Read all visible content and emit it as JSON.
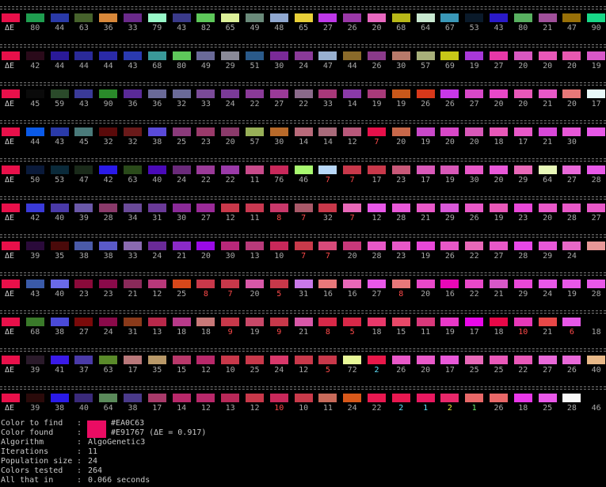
{
  "delta_label": "ΔE",
  "generations": [
    {
      "colors": [
        "#e8104a",
        "#1f9e50",
        "#2a3aa8",
        "#46622c",
        "#d8883a",
        "#6a2a8a",
        "#98f8c8",
        "#3a3a8a",
        "#5ec85a",
        "#dcf098",
        "#6a8a7a",
        "#90a8d0",
        "#e8d038",
        "#be38e8",
        "#9a38a8",
        "#e868c0",
        "#b8b818",
        "#c8e8d0",
        "#3a98b8",
        "#0a1a2a",
        "#2a1ac8",
        "#58b060",
        "#a0509a",
        "#987008",
        "#18d888"
      ],
      "deltas": [
        "80",
        "44",
        "63",
        "36",
        "33",
        "79",
        "43",
        "82",
        "65",
        "49",
        "48",
        "65",
        "27",
        "26",
        "20",
        "68",
        "64",
        "67",
        "53",
        "43",
        "80",
        "21",
        "47",
        "90"
      ],
      "flags": []
    },
    {
      "colors": [
        "#e8104a",
        "#2a0a1a",
        "#2a1a98",
        "#2a2a98",
        "#2a2aa8",
        "#2a3ab0",
        "#3a9898",
        "#5ec85a",
        "#6a6a98",
        "#8a8a98",
        "#2a5a8a",
        "#7a2a98",
        "#8a3a98",
        "#98b0d0",
        "#8a6a2a",
        "#8a3a8a",
        "#b87a6a",
        "#a8b07a",
        "#c8c818",
        "#a838d8",
        "#e838a8",
        "#d858c0",
        "#e858b8",
        "#e858b0",
        "#d858c8"
      ],
      "deltas": [
        "42",
        "44",
        "44",
        "44",
        "43",
        "68",
        "80",
        "49",
        "29",
        "51",
        "30",
        "24",
        "47",
        "44",
        "26",
        "30",
        "57",
        "69",
        "19",
        "27",
        "20",
        "20",
        "20",
        "19"
      ],
      "flags": []
    },
    {
      "colors": [
        "#e8104a",
        "#0a0a0a",
        "#2a4a2a",
        "#3a3a98",
        "#2a8a2a",
        "#5a2a98",
        "#6a6a98",
        "#6a6a98",
        "#7a4a98",
        "#7a3a98",
        "#8a3a98",
        "#9a3a98",
        "#8a6a8a",
        "#a8387a",
        "#8a3aa8",
        "#a83a7a",
        "#c8581a",
        "#d8381a",
        "#c838e8",
        "#d848c8",
        "#e848c8",
        "#e858b8",
        "#e858c8",
        "#e87878",
        "#e8f8f8"
      ],
      "deltas": [
        "45",
        "59",
        "43",
        "90",
        "36",
        "36",
        "32",
        "33",
        "24",
        "22",
        "27",
        "22",
        "33",
        "14",
        "19",
        "19",
        "26",
        "26",
        "27",
        "20",
        "20",
        "21",
        "20",
        "17",
        "49"
      ],
      "flags": []
    },
    {
      "colors": [
        "#e8104a",
        "#0a5ae8",
        "#2a3aa8",
        "#4a7a7a",
        "#5a0a0a",
        "#6a1a1a",
        "#5a4ad8",
        "#8a3a7a",
        "#9a3a6a",
        "#8a3a6a",
        "#98b058",
        "#b86a2a",
        "#b86a7a",
        "#a86a7a",
        "#b8587a",
        "#e8104a",
        "#c8684a",
        "#c848c8",
        "#d848c8",
        "#d858b8",
        "#e858b8",
        "#e858c8",
        "#d848d8",
        "#e858d8",
        "#e858e8"
      ],
      "deltas": [
        "44",
        "43",
        "45",
        "32",
        "32",
        "38",
        "25",
        "23",
        "20",
        "57",
        "30",
        "14",
        "14",
        "12",
        "7",
        "20",
        "19",
        "20",
        "20",
        "18",
        "17",
        "21",
        "30"
      ],
      "flags": [
        "",
        "",
        "",
        "",
        "",
        "",
        "",
        "",
        "",
        "",
        "",
        "",
        "",
        "",
        "hot",
        "",
        "",
        "",
        "",
        "",
        "",
        "",
        "",
        ""
      ]
    },
    {
      "colors": [
        "#e8104a",
        "#0a1a3a",
        "#0a2a3a",
        "#1a2a1a",
        "#2a1ae8",
        "#2a4a1a",
        "#4a0ab8",
        "#6a2a7a",
        "#9a3a98",
        "#9a3aa8",
        "#c84a8a",
        "#c8285a",
        "#a8f870",
        "#b8d8f8",
        "#c8384a",
        "#c8384a",
        "#c85878",
        "#d858b8",
        "#d858b8",
        "#e858c8",
        "#e858d8",
        "#e868b8",
        "#e8f8b8",
        "#e868d8",
        "#e858e8"
      ],
      "deltas": [
        "50",
        "53",
        "47",
        "42",
        "63",
        "40",
        "24",
        "22",
        "22",
        "11",
        "76",
        "46",
        "7",
        "7",
        "17",
        "23",
        "17",
        "19",
        "30",
        "20",
        "29",
        "64",
        "27",
        "28"
      ],
      "flags": [
        "",
        "",
        "",
        "",
        "",
        "",
        "",
        "",
        "",
        "",
        "",
        "",
        "hot",
        "hot",
        "",
        "",
        "",
        "",
        "",
        "",
        "",
        "",
        "",
        ""
      ]
    },
    {
      "colors": [
        "#e8104a",
        "#3a3ad8",
        "#4a3aa8",
        "#6a58a8",
        "#8a3a6a",
        "#6a4a98",
        "#6a3a98",
        "#8a2a98",
        "#9a2a98",
        "#c8384a",
        "#c83850",
        "#c8386a",
        "#a85868",
        "#c8384a",
        "#e868b8",
        "#e858e8",
        "#e858d8",
        "#e858c8",
        "#d858d8",
        "#e858c8",
        "#e858b8",
        "#e848d8",
        "#e858c8",
        "#e858c8",
        "#e858c8"
      ],
      "deltas": [
        "42",
        "40",
        "39",
        "28",
        "34",
        "31",
        "30",
        "27",
        "12",
        "11",
        "8",
        "7",
        "32",
        "7",
        "12",
        "28",
        "21",
        "29",
        "26",
        "19",
        "23",
        "20",
        "28",
        "27"
      ],
      "flags": [
        "",
        "",
        "",
        "",
        "",
        "",
        "",
        "",
        "",
        "",
        "hot",
        "hot",
        "",
        "hot",
        "",
        "",
        "",
        "",
        "",
        "",
        "",
        "",
        "",
        ""
      ]
    },
    {
      "colors": [
        "#e8104a",
        "#2a0a3a",
        "#4a0a0a",
        "#4a5aa8",
        "#5a5ac8",
        "#8a6ab0",
        "#6a2a98",
        "#8a2ac8",
        "#9a0ae8",
        "#b8287a",
        "#b83a7a",
        "#c8285a",
        "#c83a4a",
        "#d84a7a",
        "#c8387a",
        "#e858c8",
        "#e858c8",
        "#e848d8",
        "#e858c8",
        "#e868b8",
        "#e858c8",
        "#e848e8",
        "#e858d8",
        "#e868c8",
        "#e89898"
      ],
      "deltas": [
        "39",
        "35",
        "38",
        "38",
        "33",
        "24",
        "21",
        "20",
        "30",
        "13",
        "10",
        "7",
        "7",
        "20",
        "28",
        "23",
        "19",
        "26",
        "22",
        "27",
        "28",
        "29",
        "24"
      ],
      "flags": [
        "",
        "",
        "",
        "",
        "",
        "",
        "",
        "",
        "",
        "",
        "",
        "hot",
        "hot",
        "",
        "",
        "",
        "",
        "",
        "",
        "",
        "",
        "",
        ""
      ]
    },
    {
      "colors": [
        "#e8104a",
        "#3a5aa8",
        "#6a6ae8",
        "#8a0a3a",
        "#8a0a4a",
        "#8a2a5a",
        "#b8387a",
        "#d8481a",
        "#c8384a",
        "#c8384a",
        "#d858a8",
        "#c8384a",
        "#c878e8",
        "#e8787a",
        "#e868b8",
        "#e858e8",
        "#e8787a",
        "#e848c8",
        "#e808b8",
        "#e848c8",
        "#d858c8",
        "#e848d8",
        "#e858e8",
        "#e858e8",
        "#e858e8"
      ],
      "deltas": [
        "43",
        "40",
        "23",
        "23",
        "21",
        "12",
        "25",
        "8",
        "7",
        "20",
        "5",
        "31",
        "16",
        "16",
        "27",
        "8",
        "20",
        "16",
        "22",
        "21",
        "29",
        "24",
        "19",
        "28"
      ],
      "flags": [
        "",
        "",
        "",
        "",
        "",
        "",
        "",
        "hot",
        "hot",
        "",
        "hot",
        "",
        "",
        "",
        "",
        "hot",
        "",
        "",
        "",
        "",
        "",
        "",
        "",
        ""
      ]
    },
    {
      "colors": [
        "#e8104a",
        "#3a7a2a",
        "#4a4ad8",
        "#7a0a0a",
        "#8a0a4a",
        "#8a3a1a",
        "#b8284a",
        "#b83a8a",
        "#c87878",
        "#c8384a",
        "#c84868",
        "#c8384a",
        "#d858a8",
        "#d82848",
        "#d82848",
        "#e8386a",
        "#e84868",
        "#d8387a",
        "#e838c8",
        "#e808e8",
        "#e80848",
        "#e838b8",
        "#e84848",
        "#e858e8"
      ],
      "deltas": [
        "68",
        "38",
        "27",
        "24",
        "31",
        "13",
        "18",
        "18",
        "9",
        "19",
        "9",
        "21",
        "8",
        "5",
        "18",
        "15",
        "11",
        "19",
        "17",
        "18",
        "10",
        "21",
        "6",
        "18"
      ],
      "flags": [
        "",
        "",
        "",
        "",
        "",
        "",
        "",
        "",
        "hot",
        "",
        "hot",
        "",
        "hot",
        "hot",
        "",
        "",
        "",
        "",
        "",
        "",
        "hot",
        "",
        "hot",
        ""
      ]
    },
    {
      "colors": [
        "#e8104a",
        "#2a1a2a",
        "#3a1ae8",
        "#4a3aa8",
        "#5a8a2a",
        "#b8787a",
        "#b89868",
        "#b8386a",
        "#b8286a",
        "#c8384a",
        "#c8384a",
        "#d8386a",
        "#c8384a",
        "#c8384a",
        "#e8f898",
        "#e8184a",
        "#e858c8",
        "#e858c8",
        "#e858d8",
        "#e868b8",
        "#e858b8",
        "#e858b8",
        "#e868d8",
        "#e868d8",
        "#e8b888"
      ],
      "deltas": [
        "39",
        "41",
        "37",
        "63",
        "17",
        "35",
        "15",
        "12",
        "10",
        "25",
        "24",
        "12",
        "5",
        "72",
        "2",
        "26",
        "20",
        "17",
        "25",
        "25",
        "22",
        "27",
        "26",
        "40"
      ],
      "flags": [
        "",
        "",
        "",
        "",
        "",
        "",
        "",
        "",
        "",
        "",
        "",
        "",
        "hot",
        "",
        "hit",
        "",
        "",
        "",
        "",
        "",
        "",
        "",
        "",
        ""
      ]
    },
    {
      "colors": [
        "#e8104a",
        "#2a0a0a",
        "#2a1ae8",
        "#3a2a7a",
        "#5a8a5a",
        "#4a3a8a",
        "#a83a6a",
        "#b8286a",
        "#b8286a",
        "#b82858",
        "#c8384a",
        "#c8285a",
        "#c83a4a",
        "#c86a5a",
        "#d8581a",
        "#e81850",
        "#e81850",
        "#e81860",
        "#e8286a",
        "#e86868",
        "#e86868",
        "#e838e8",
        "#e858e8",
        "#f8f8f8"
      ],
      "deltas": [
        "39",
        "38",
        "40",
        "64",
        "38",
        "17",
        "14",
        "12",
        "13",
        "12",
        "10",
        "10",
        "11",
        "24",
        "22",
        "2",
        "1",
        "2",
        "1",
        "26",
        "18",
        "25",
        "28",
        "46"
      ],
      "flags": [
        "",
        "",
        "",
        "",
        "",
        "",
        "",
        "",
        "",
        "",
        "hot",
        "",
        "",
        "",
        "",
        "hit",
        "hit",
        "lime",
        "grn",
        "",
        "",
        "",
        "",
        ""
      ]
    }
  ],
  "summary": {
    "find_label": "Color to find",
    "find_value": "#EA0C63",
    "found_label": "Color found",
    "found_value": "#E91767 (ΔE = 0.917)",
    "algo_label": "Algorithm",
    "algo_value": "AlgoGenetic3",
    "iter_label": "Iterations",
    "iter_value": "11",
    "pop_label": "Population size",
    "pop_value": "24",
    "tested_label": "Colors tested",
    "tested_value": "264",
    "time_label": "All that in",
    "time_value": "0.066 seconds",
    "colon": ":",
    "target_color": "#ea0c63"
  }
}
